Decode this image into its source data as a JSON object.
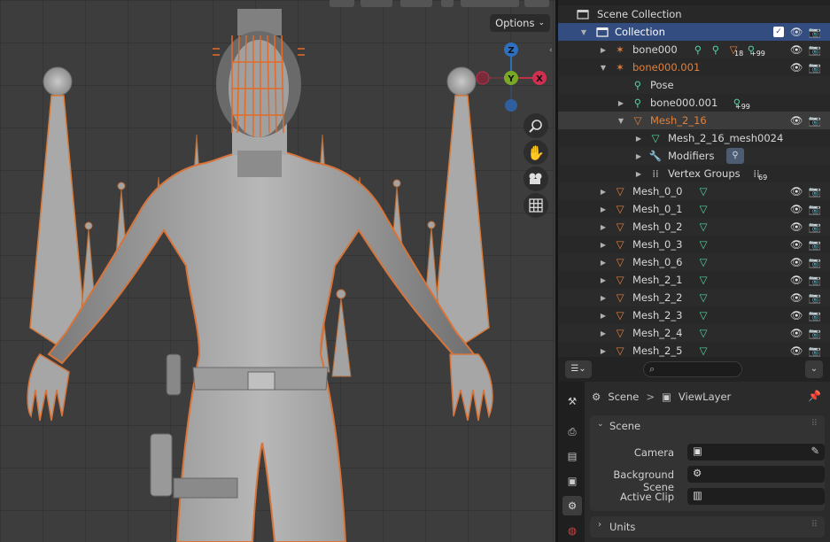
{
  "viewport": {
    "options_label": "Options",
    "gizmo": {
      "z": "Z",
      "y": "Y",
      "x": "X"
    },
    "tools": [
      "zoom-icon",
      "hand-icon",
      "camera-icon",
      "grid-icon"
    ]
  },
  "outliner": {
    "scene_collection": "Scene Collection",
    "collection": "Collection",
    "rows": [
      {
        "label": "bone000",
        "badge": "18",
        "badge2": "+99"
      },
      {
        "label": "bone000.001"
      },
      {
        "label": "Pose"
      },
      {
        "label": "bone000.001",
        "badge": "+99"
      },
      {
        "label": "Mesh_2_16"
      },
      {
        "label": "Mesh_2_16_mesh0024"
      },
      {
        "label": "Modifiers"
      },
      {
        "label": "Vertex Groups",
        "badge": "69"
      },
      {
        "label": "Mesh_0_0"
      },
      {
        "label": "Mesh_0_1"
      },
      {
        "label": "Mesh_0_2"
      },
      {
        "label": "Mesh_0_3"
      },
      {
        "label": "Mesh_0_6"
      },
      {
        "label": "Mesh_2_1"
      },
      {
        "label": "Mesh_2_2"
      },
      {
        "label": "Mesh_2_3"
      },
      {
        "label": "Mesh_2_4"
      },
      {
        "label": "Mesh_2_5"
      }
    ]
  },
  "properties": {
    "breadcrumb_scene": "Scene",
    "breadcrumb_sep": ">",
    "breadcrumb_viewlayer": "ViewLayer",
    "panel_scene": "Scene",
    "camera_label": "Camera",
    "bg_scene_label": "Background Scene",
    "active_clip_label": "Active Clip",
    "panel_units": "Units"
  },
  "colors": {
    "selection": "#334d80",
    "active_orange": "#e2803c",
    "mesh_green": "#4fd7a0"
  }
}
